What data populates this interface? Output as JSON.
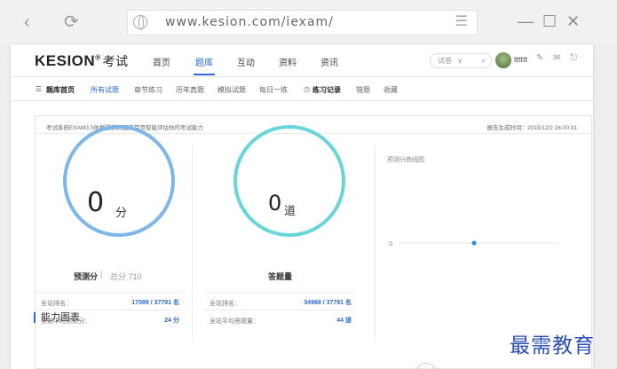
{
  "browser": {
    "url": "www.kesion.com/iexam/",
    "back_icon": "‹",
    "reload_icon": "⟳",
    "menu_icon": "☰",
    "minimize_icon": "—",
    "maximize_icon": "☐",
    "close_icon": "✕"
  },
  "header": {
    "logo_brand": "KESION",
    "logo_mark": "®",
    "logo_sub": "考试",
    "nav": [
      "首页",
      "题库",
      "互动",
      "资料",
      "资讯"
    ],
    "active_nav": "题库",
    "search_placeholder": "试卷",
    "search_arrow": "∨",
    "search_icon": "⌕",
    "username": "tttttt",
    "icons_text": "✎ ✉ ⎋"
  },
  "subnav": {
    "grid_icon": "☰",
    "items": [
      "题库首页",
      "所有试题",
      "章节练习",
      "历年真题",
      "模拟试题",
      "每日一练",
      "练习记录",
      "错题",
      "收藏"
    ],
    "clock_icon": "◷"
  },
  "card": {
    "desc": "考试系统EXAM3.5依据最新的题库首页智能评估你的考试能力",
    "report_time": "报告生成时间：2015/12/2 16:00:31"
  },
  "score_panel": {
    "value": "0",
    "unit": "分",
    "label": "预测分",
    "divider": "|",
    "total": "总分 710",
    "rows": [
      {
        "key": "全站排名：",
        "value": "17089 / 37791 名"
      },
      {
        "key": "全站平均预测分：",
        "value": "24 分"
      }
    ]
  },
  "answer_panel": {
    "value": "0",
    "unit": "道",
    "label": "答题量",
    "rows": [
      {
        "key": "全站排名：",
        "value": "34968 / 37791 名"
      },
      {
        "key": "全站平均答题量：",
        "value": "44 道"
      }
    ]
  },
  "chart_data": {
    "type": "line",
    "title": "预测分曲线图",
    "x": [
      0
    ],
    "series": [
      {
        "values": [
          0
        ]
      }
    ],
    "x_tick_labels": [
      "0"
    ],
    "y_tick_labels": [
      "0"
    ],
    "grid": true
  },
  "section_title": "能力图表",
  "watermark": "最需教育"
}
